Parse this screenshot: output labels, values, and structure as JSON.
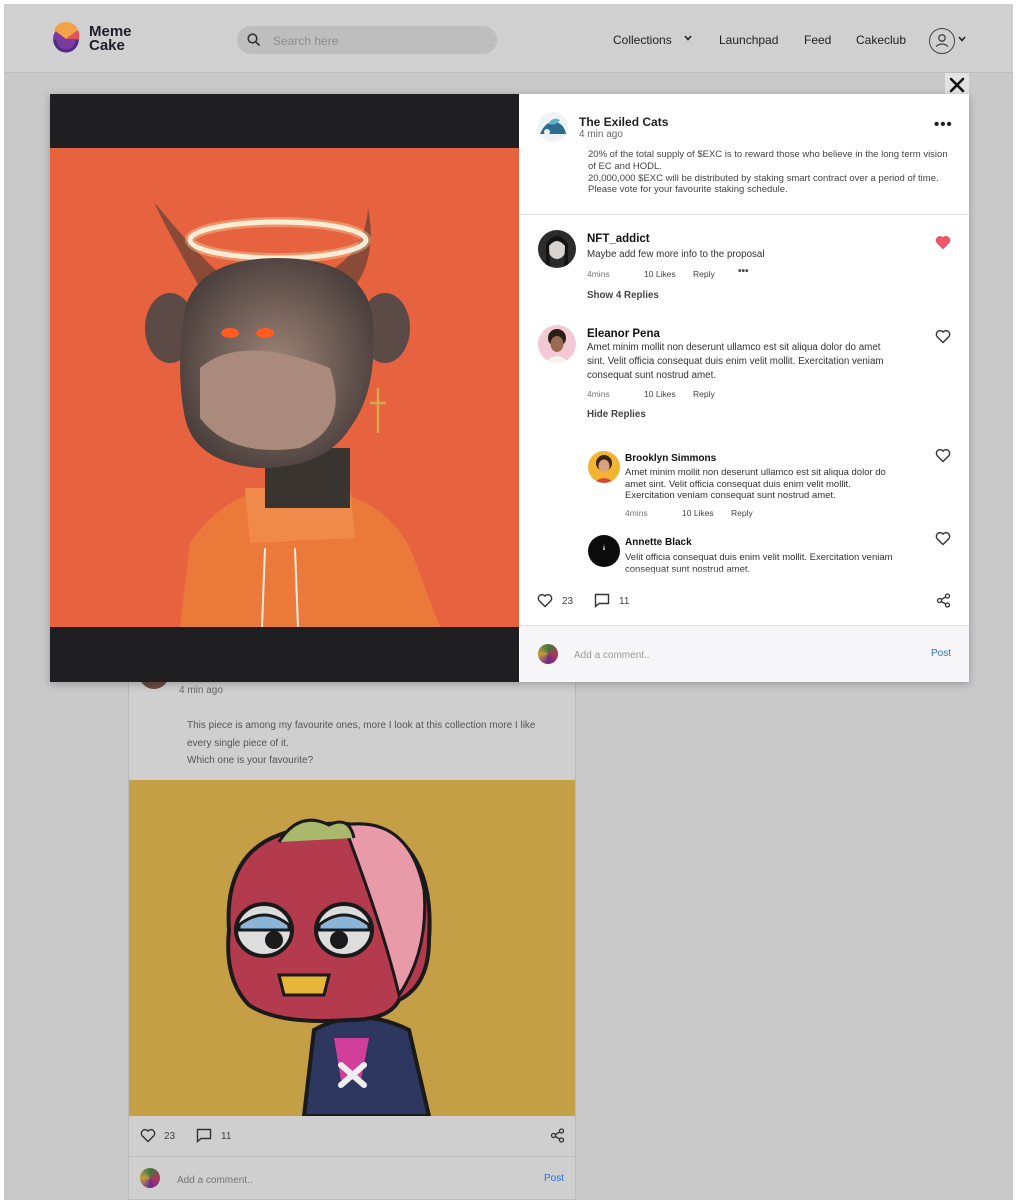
{
  "header": {
    "logo_line1": "Meme",
    "logo_line2": "Cake",
    "search_placeholder": "Search here",
    "nav": [
      "Collections",
      "Launchpad",
      "Feed",
      "Cakeclub"
    ]
  },
  "modal": {
    "author": "The Exiled Cats",
    "time": "4 min ago",
    "text_lines": [
      "20% of the total supply of $EXC is to reward those who believe in the long term vision of EC and HODL.",
      "20,000,000 $EXC will be distributed by staking smart contract over a period of time.",
      "Please vote for your favourite staking schedule."
    ],
    "comments": [
      {
        "name": "NFT_addict",
        "text": "Maybe add few more info to the proposal",
        "time": "4mins",
        "likes": "10 Likes",
        "reply": "Reply",
        "liked": true,
        "toggle": "Show 4 Replies"
      },
      {
        "name": "Eleanor Pena",
        "text": "Amet minim mollit non deserunt ullamco est sit aliqua dolor do amet sint. Velit officia consequat duis enim velit mollit. Exercitation veniam consequat sunt nostrud amet.",
        "time": "4mins",
        "likes": "10 Likes",
        "reply": "Reply",
        "liked": false,
        "toggle": "Hide Replies",
        "replies": [
          {
            "name": "Brooklyn Simmons",
            "text": "Amet minim mollit non deserunt ullamco est sit aliqua dolor do amet sint. Velit officia consequat duis enim velit mollit. Exercitation veniam consequat sunt nostrud amet.",
            "time": "4mins",
            "likes": "10 Likes",
            "reply": "Reply"
          },
          {
            "name": "Annette Black",
            "text": "Velit officia consequat duis enim velit mollit. Exercitation veniam consequat sunt nostrud amet."
          }
        ]
      }
    ],
    "like_count": "23",
    "comment_count": "11",
    "comment_placeholder": "Add a comment..",
    "post_label": "Post"
  },
  "background_post": {
    "time": "4 min ago",
    "text_lines": [
      "This piece is among my favourite ones, more I look at this collection more I like",
      "every single piece of it.",
      "Which one is your favourite?"
    ],
    "like_count": "23",
    "comment_count": "11",
    "comment_placeholder": "Add a comment..",
    "post_label": "Post"
  },
  "colors": {
    "accent_link": "#2f6fd0",
    "liked_heart": "#f0586a",
    "modal_image_bg": "#e7633f",
    "bg_image_bg": "#c49f45"
  }
}
